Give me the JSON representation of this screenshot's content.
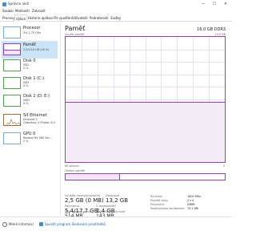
{
  "window": {
    "title": "Správce úloh",
    "minimize": "—",
    "maximize": "☐",
    "close": "✕"
  },
  "menu": [
    "Soubor",
    "Možnosti",
    "Zobrazit"
  ],
  "tabs": [
    "Procesy",
    "Výkon",
    "Historie aplikací",
    "Po spuštění",
    "Uživatelé",
    "Podrobnosti",
    "Služby"
  ],
  "sidebar": [
    {
      "name": "Procesor",
      "sub": "3% 1,75 GHz"
    },
    {
      "name": "Paměť",
      "sub": "2,5/13,9 GB (18 %)"
    },
    {
      "name": "Disk 0",
      "sub": "SSD",
      "sub2": "0 %"
    },
    {
      "name": "Disk 1 (C:)",
      "sub": "SSD",
      "sub2": "0 %"
    },
    {
      "name": "Disk 2 (D: E:)",
      "sub": "HDD",
      "sub2": "0 %"
    },
    {
      "name": "Síť Ethernet",
      "sub": "Ethernet 2",
      "sub2": "Odesláno: 0 Přijato: 8,0"
    },
    {
      "name": "GPU 0",
      "sub": "Radeon RX 580 Ser...",
      "sub2": "2 %"
    }
  ],
  "main": {
    "title": "Paměť",
    "capacity": "16,0 GB DDR3",
    "usage_label": "Využití paměti",
    "usage_max": "13,9 GB",
    "time_label": "60 sekund",
    "time_end": "0",
    "composition_label": "Složení paměti",
    "usage_fraction": 0.18
  },
  "stats": [
    {
      "label": "Využitá (komprimovaná)",
      "value": "2,5 GB (0 MB)"
    },
    {
      "label": "Dostupné",
      "value": "13,2 GB"
    },
    {
      "label": "Potvrzeno",
      "value": "5,4/17,7 GB"
    },
    {
      "label": "V mezipaměti",
      "value": "2,4 GB"
    },
    {
      "label": "Stránkovaný fond",
      "value": "514 MB"
    },
    {
      "label": "Nestránkovaný fond",
      "value": "143 MB"
    }
  ],
  "info": [
    {
      "label": "Rychlost:",
      "value": "1600 MHz"
    },
    {
      "label": "Použité sloty:",
      "value": "2 z 4"
    },
    {
      "label": "Provedení:",
      "value": "DIMM"
    },
    {
      "label": "Rezervováno hardwarem:",
      "value": "70,1 MB"
    }
  ],
  "footer": {
    "less_details": "Méně informací",
    "open_monitor": "Spustit program Sledování prostředků"
  }
}
